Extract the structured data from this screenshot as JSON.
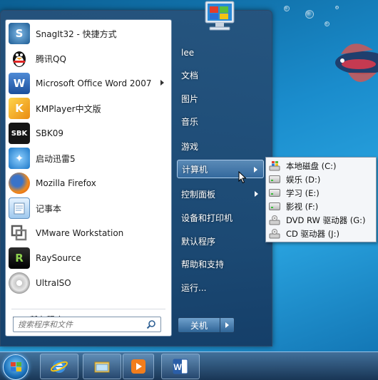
{
  "start_menu": {
    "programs": [
      {
        "label": "SnagIt32 - 快捷方式",
        "icon": "snagit-icon",
        "has_submenu": false
      },
      {
        "label": "腾讯QQ",
        "icon": "qq-penguin-icon",
        "has_submenu": false
      },
      {
        "label": "Microsoft Office Word 2007",
        "icon": "word-icon",
        "has_submenu": true
      },
      {
        "label": "KMPlayer中文版",
        "icon": "kmplayer-icon",
        "has_submenu": false
      },
      {
        "label": "SBK09",
        "icon": "sbk09-icon",
        "has_submenu": false
      },
      {
        "label": "启动迅雷5",
        "icon": "thunder-icon",
        "has_submenu": false
      },
      {
        "label": "Mozilla Firefox",
        "icon": "firefox-icon",
        "has_submenu": false
      },
      {
        "label": "记事本",
        "icon": "notepad-icon",
        "has_submenu": false
      },
      {
        "label": "VMware Workstation",
        "icon": "vmware-icon",
        "has_submenu": false
      },
      {
        "label": "RaySource",
        "icon": "raysource-icon",
        "has_submenu": false
      },
      {
        "label": "UltraISO",
        "icon": "ultraiso-icon",
        "has_submenu": false
      }
    ],
    "all_programs_label": "所有程序",
    "search_placeholder": "搜索程序和文件",
    "right_items": [
      {
        "label": "lee",
        "has_submenu": false,
        "active": false
      },
      {
        "label": "文档",
        "has_submenu": false,
        "active": false
      },
      {
        "label": "图片",
        "has_submenu": false,
        "active": false
      },
      {
        "label": "音乐",
        "has_submenu": false,
        "active": false
      },
      {
        "label": "游戏",
        "has_submenu": false,
        "active": false
      },
      {
        "label": "计算机",
        "has_submenu": true,
        "active": true
      },
      {
        "label": "控制面板",
        "has_submenu": true,
        "active": false
      },
      {
        "label": "设备和打印机",
        "has_submenu": false,
        "active": false
      },
      {
        "label": "默认程序",
        "has_submenu": false,
        "active": false
      },
      {
        "label": "帮助和支持",
        "has_submenu": false,
        "active": false
      },
      {
        "label": "运行...",
        "has_submenu": false,
        "active": false
      }
    ],
    "shutdown_label": "关机"
  },
  "computer_submenu": [
    {
      "label": "本地磁盘 (C:)",
      "icon": "windows-drive-icon"
    },
    {
      "label": "娱乐 (D:)",
      "icon": "hard-drive-icon"
    },
    {
      "label": "学习 (E:)",
      "icon": "hard-drive-icon"
    },
    {
      "label": "影视 (F:)",
      "icon": "hard-drive-icon"
    },
    {
      "label": "DVD RW 驱动器 (G:)",
      "icon": "dvd-drive-icon"
    },
    {
      "label": "CD 驱动器 (J:)",
      "icon": "cd-drive-icon"
    }
  ],
  "taskbar": {
    "items": [
      "start-orb",
      "internet-explorer-icon",
      "file-explorer-icon",
      "media-player-icon",
      "word-icon"
    ]
  },
  "colors": {
    "accent": "#2f6597",
    "desktop": "#1a8ccc"
  }
}
